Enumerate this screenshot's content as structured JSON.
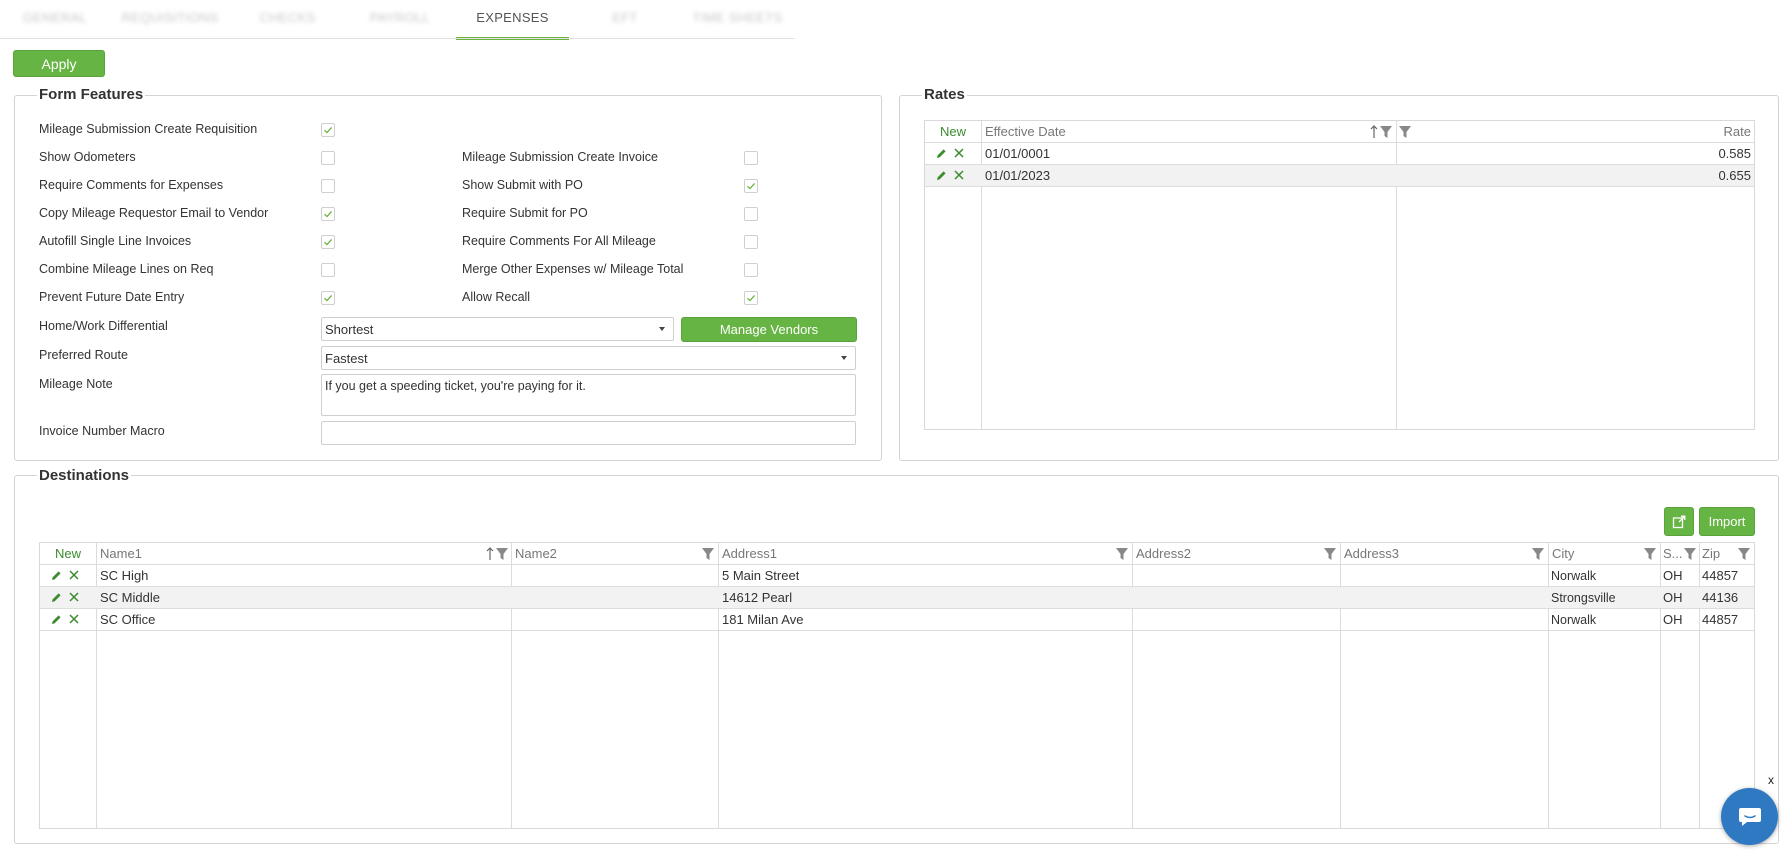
{
  "tabs": [
    {
      "label": "GENERAL",
      "blurred": true
    },
    {
      "label": "REQUISITIONS",
      "blurred": true
    },
    {
      "label": "CHECKS",
      "blurred": true
    },
    {
      "label": "PAYROLL",
      "blurred": true
    },
    {
      "label": "EXPENSES",
      "blurred": false,
      "active": true
    },
    {
      "label": "EFT",
      "blurred": true
    },
    {
      "label": "TIME SHEETS",
      "blurred": true
    }
  ],
  "apply_label": "Apply",
  "form_features": {
    "title": "Form Features",
    "left_checks": [
      {
        "label": "Mileage Submission Create Requisition",
        "checked": true
      },
      {
        "label": "Show Odometers",
        "checked": false
      },
      {
        "label": "Require Comments for Expenses",
        "checked": false
      },
      {
        "label": "Copy Mileage Requestor Email to Vendor",
        "checked": true
      },
      {
        "label": "Autofill Single Line Invoices",
        "checked": true
      },
      {
        "label": "Combine Mileage Lines on Req",
        "checked": false
      },
      {
        "label": "Prevent Future Date Entry",
        "checked": true
      }
    ],
    "right_checks": [
      {
        "label": "Mileage Submission Create Invoice",
        "checked": false
      },
      {
        "label": "Show Submit with PO",
        "checked": true
      },
      {
        "label": "Require Submit for PO",
        "checked": false
      },
      {
        "label": "Require Comments For All Mileage",
        "checked": false
      },
      {
        "label": "Merge Other Expenses w/ Mileage Total",
        "checked": false
      },
      {
        "label": "Allow Recall",
        "checked": true
      }
    ],
    "home_work_label": "Home/Work Differential",
    "home_work_value": "Shortest",
    "manage_vendors_label": "Manage Vendors",
    "preferred_route_label": "Preferred Route",
    "preferred_route_value": "Fastest",
    "mileage_note_label": "Mileage Note",
    "mileage_note_value": "If you get a speeding ticket, you're paying for it.",
    "invoice_macro_label": "Invoice Number Macro",
    "invoice_macro_value": ""
  },
  "rates": {
    "title": "Rates",
    "new_label": "New",
    "col_effective": "Effective Date",
    "col_rate": "Rate",
    "rows": [
      {
        "date": "01/01/0001",
        "rate": "0.585"
      },
      {
        "date": "01/01/2023",
        "rate": "0.655"
      }
    ]
  },
  "destinations": {
    "title": "Destinations",
    "import_label": "Import",
    "new_label": "New",
    "columns": [
      "Name1",
      "Name2",
      "Address1",
      "Address2",
      "Address3",
      "City",
      "S...",
      "Zip"
    ],
    "rows": [
      {
        "name1": "SC High",
        "name2": "",
        "address1": "5 Main Street",
        "address2": "",
        "address3": "",
        "city": "Norwalk",
        "state": "OH",
        "zip": "44857"
      },
      {
        "name1": "SC Middle",
        "name2": "",
        "address1": "14612 Pearl",
        "address2": "",
        "address3": "",
        "city": "Strongsville",
        "state": "OH",
        "zip": "44136"
      },
      {
        "name1": "SC Office",
        "name2": "",
        "address1": "181 Milan Ave",
        "address2": "",
        "address3": "",
        "city": "Norwalk",
        "state": "OH",
        "zip": "44857"
      }
    ]
  },
  "chat_close_label": "x",
  "colors": {
    "accent": "#66b443",
    "chat": "#2f79c2"
  }
}
